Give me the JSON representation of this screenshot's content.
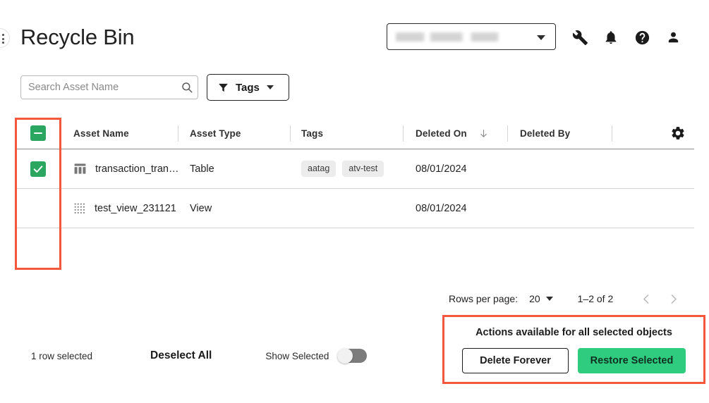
{
  "header": {
    "title": "Recycle Bin",
    "corner_icon": "more-vertical-icon",
    "account_selector": {
      "value": "",
      "redacted": true,
      "caret_icon": "chevron-down-icon"
    },
    "icons": [
      {
        "name": "wrench-icon",
        "label": "Tools"
      },
      {
        "name": "bell-icon",
        "label": "Notifications"
      },
      {
        "name": "help-icon",
        "label": "Help"
      },
      {
        "name": "account-icon",
        "label": "Account"
      }
    ]
  },
  "filters": {
    "search": {
      "placeholder": "Search Asset Name",
      "value": "",
      "icon": "search-icon"
    },
    "tags_button": {
      "label": "Tags",
      "icon": "filter-funnel-icon",
      "caret_icon": "chevron-down-icon"
    }
  },
  "table": {
    "select_all_state": "indeterminate",
    "settings_icon": "gear-icon",
    "sort_icon": "arrow-down-icon",
    "sorted_column": "Deleted On",
    "columns": [
      {
        "key": "asset_name",
        "label": "Asset Name"
      },
      {
        "key": "asset_type",
        "label": "Asset Type"
      },
      {
        "key": "tags",
        "label": "Tags"
      },
      {
        "key": "deleted_on",
        "label": "Deleted On"
      },
      {
        "key": "deleted_by",
        "label": "Deleted By"
      }
    ],
    "rows": [
      {
        "selected": true,
        "icon": "table-asset-icon",
        "asset_name": "transaction_tran…",
        "asset_type": "Table",
        "tags": [
          "aatag",
          "atv-test"
        ],
        "deleted_on": "08/01/2024",
        "deleted_by": "",
        "deleted_by_redacted": true
      },
      {
        "selected": false,
        "icon": "view-asset-icon",
        "asset_name": "test_view_231121",
        "asset_type": "View",
        "tags": [],
        "deleted_on": "08/01/2024",
        "deleted_by": "",
        "deleted_by_redacted": true
      }
    ]
  },
  "pagination": {
    "rows_per_page_label": "Rows per page:",
    "rows_per_page_value": "20",
    "range_label": "1–2 of 2",
    "prev_icon": "chevron-left-icon",
    "next_icon": "chevron-right-icon",
    "prev_enabled": false,
    "next_enabled": false
  },
  "selection_bar": {
    "count_label": "1 row selected",
    "deselect_label": "Deselect All",
    "show_selected_label": "Show Selected",
    "show_selected_on": false
  },
  "actions_panel": {
    "title": "Actions available for all selected objects",
    "delete_label": "Delete Forever",
    "restore_label": "Restore Selected"
  },
  "colors": {
    "accent_green": "#2aa661",
    "restore_green": "#2fcc80",
    "annotation_red": "#f4583c"
  }
}
